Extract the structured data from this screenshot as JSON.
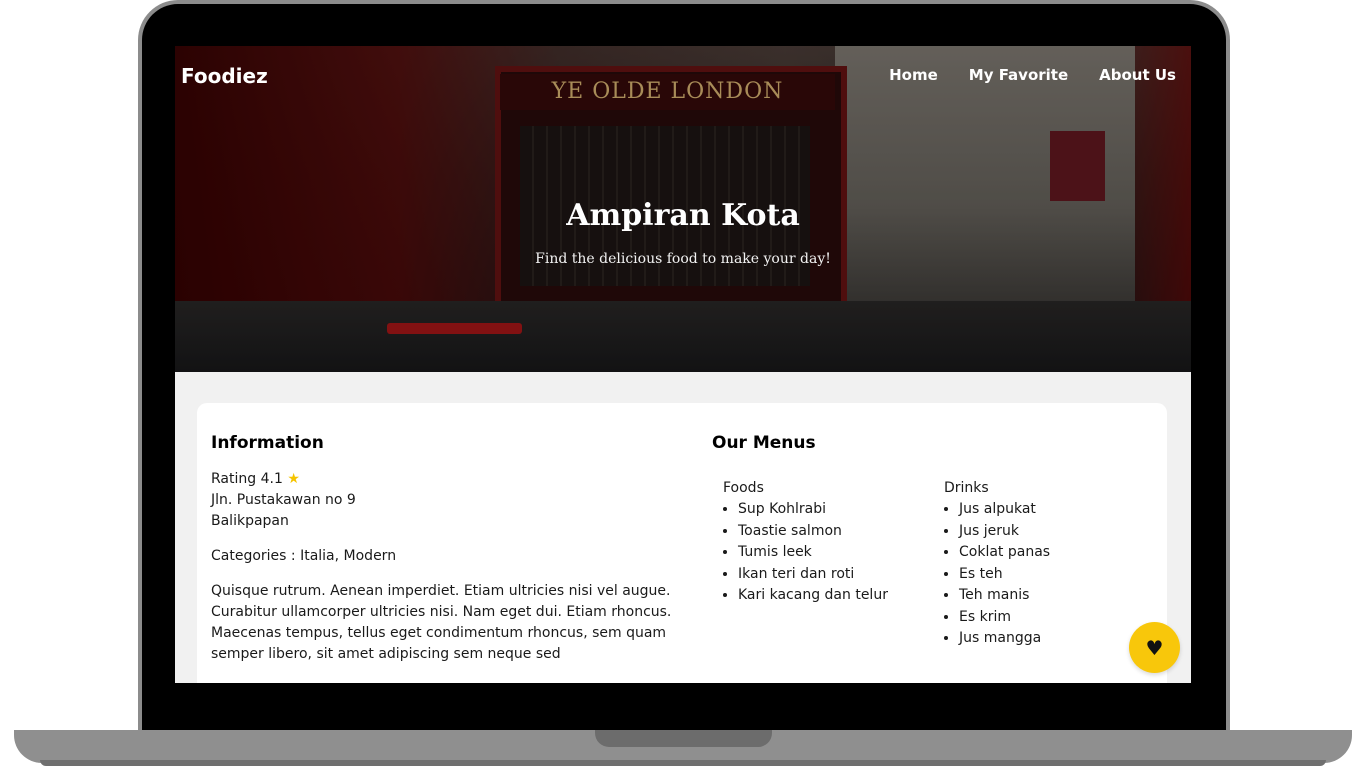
{
  "header": {
    "brand": "Foodiez",
    "nav": [
      "Home",
      "My Favorite",
      "About Us"
    ]
  },
  "hero": {
    "sign_text": "YE OLDE LONDON",
    "title": "Ampiran Kota",
    "subtitle": "Find the delicious food to make your day!"
  },
  "information": {
    "heading": "Information",
    "rating_label": "Rating 4.1",
    "rating_icon": "star-icon",
    "address": "Jln. Pustakawan no 9",
    "city": "Balikpapan",
    "categories": "Categories : Italia, Modern",
    "description": "Quisque rutrum. Aenean imperdiet. Etiam ultricies nisi vel augue. Curabitur ullamcorper ultricies nisi. Nam eget dui. Etiam rhoncus. Maecenas tempus, tellus eget condimentum rhoncus, sem quam semper libero, sit amet adipiscing sem neque sed"
  },
  "menus": {
    "heading": "Our Menus",
    "foods_title": "Foods",
    "foods": [
      "Sup Kohlrabi",
      "Toastie salmon",
      "Tumis leek",
      "Ikan teri dan roti",
      "Kari kacang dan telur"
    ],
    "drinks_title": "Drinks",
    "drinks": [
      "Jus alpukat",
      "Jus jeruk",
      "Coklat panas",
      "Es teh",
      "Teh manis",
      "Es krim",
      "Jus mangga"
    ]
  },
  "favorite_button": {
    "icon": "heart-icon",
    "color": "#f8c70b"
  },
  "colors": {
    "accent": "#f8c70b",
    "star": "#f5c400"
  }
}
